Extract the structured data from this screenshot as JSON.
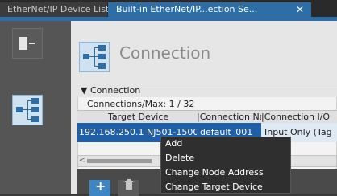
{
  "tabs": {
    "inactive": "EtherNet/IP Device List",
    "active": "Built-in EtherNet/IP...ection Se...",
    "close_glyph": "✕"
  },
  "header": {
    "title": "Connection",
    "icon": "connection-icon"
  },
  "panel": {
    "title": "▼ Connection",
    "max_line": "Connections/Max: 1 / 32"
  },
  "table": {
    "columns": [
      "Target Device",
      "|Connection Na",
      "|Connection I/O"
    ],
    "rows": [
      [
        "192.168.250.1 NJ501-1500",
        "default_001",
        "Input Only (Tag"
      ]
    ]
  },
  "context_menu": {
    "items": [
      "Add",
      "Delete",
      "Change Node Address",
      "Change Target Device"
    ]
  },
  "toolbar": {
    "add_glyph": "+",
    "delete_icon": "trash-icon"
  },
  "colors": {
    "accent": "#2e6ea6",
    "selection": "#1f5fa8",
    "menu_bg": "#2f2f2f"
  }
}
